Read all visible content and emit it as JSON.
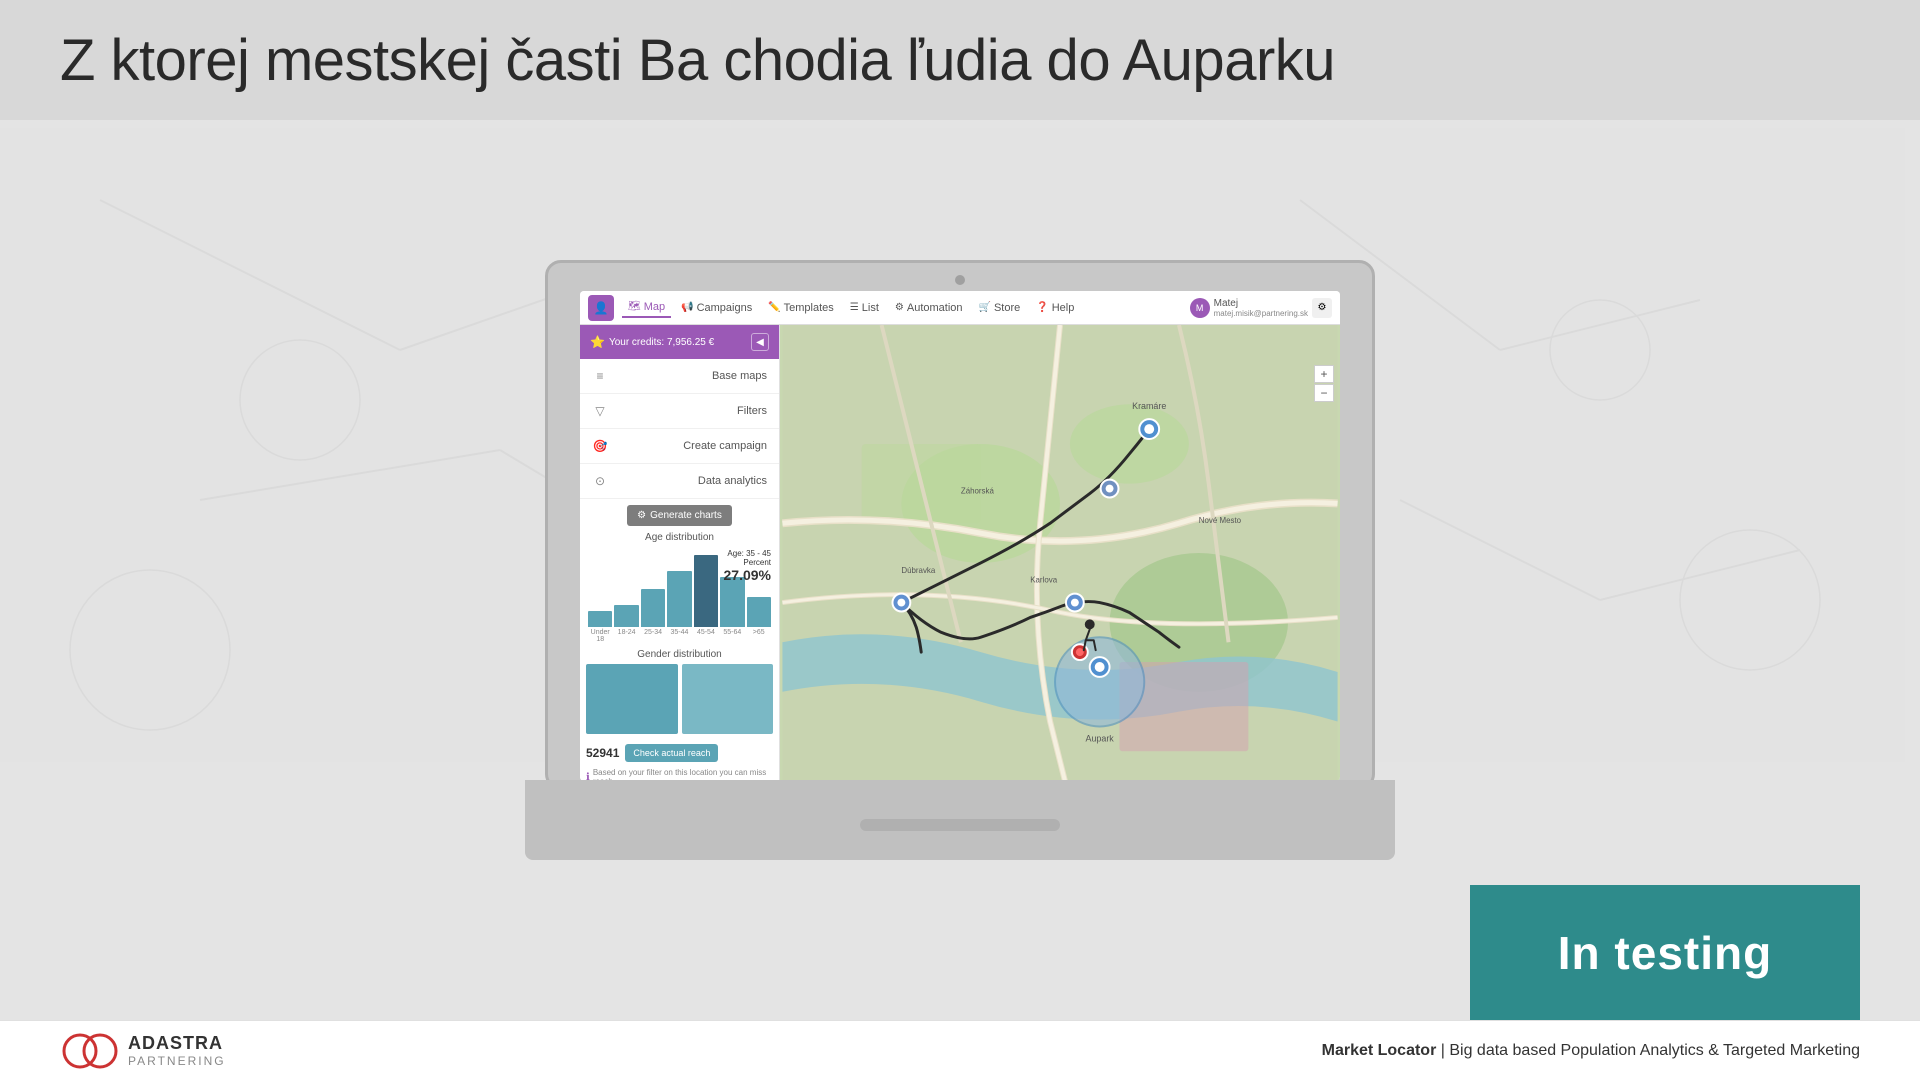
{
  "header": {
    "title": "Z ktorej mestskej časti Ba chodia ľudia do Auparku"
  },
  "nav": {
    "user_icon": "👤",
    "items": [
      {
        "label": "Map",
        "icon": "🗺",
        "active": true
      },
      {
        "label": "Campaigns",
        "icon": "📢",
        "active": false
      },
      {
        "label": "Templates",
        "icon": "✏️",
        "active": false
      },
      {
        "label": "List",
        "icon": "☰",
        "active": false
      },
      {
        "label": "Automation",
        "icon": "⚙",
        "active": false
      },
      {
        "label": "Store",
        "icon": "🛒",
        "active": false
      },
      {
        "label": "Help",
        "icon": "❓",
        "active": false
      }
    ],
    "user_name": "Matej",
    "user_email": "matej.misik@partnering.sk"
  },
  "sidebar": {
    "credits_label": "Your credits: 7,956.25 €",
    "menu_items": [
      {
        "label": "Base maps",
        "icon": "≡"
      },
      {
        "label": "Filters",
        "icon": "▽"
      },
      {
        "label": "Create campaign",
        "icon": "🎯"
      },
      {
        "label": "Data analytics",
        "icon": "⊙"
      }
    ],
    "generate_btn": "Generate charts",
    "age_chart": {
      "title": "Age distribution",
      "tooltip_label": "Age: 35 - 45",
      "percent_label": "Percent",
      "percent_value": "27.09%",
      "bars": [
        15,
        20,
        35,
        55,
        70,
        50,
        30
      ],
      "highlighted_index": 4,
      "labels": [
        "Under 18",
        "18 - 24",
        "25 - 34",
        "35 - 44",
        "45 - 54",
        "55 - 64",
        "Above 65"
      ]
    },
    "gender_chart": {
      "title": "Gender distribution"
    },
    "reach_number": "52941",
    "check_reach_btn": "Check actual reach",
    "reach_note": "Based on your filter on this location you can miss reach"
  },
  "in_testing": {
    "label": "In testing"
  },
  "footer": {
    "brand_name": "ADASTRA",
    "brand_sub": "Partnering",
    "tagline_bold": "Market Locator",
    "tagline_rest": " | Big data based Population Analytics & Targeted Marketing"
  }
}
